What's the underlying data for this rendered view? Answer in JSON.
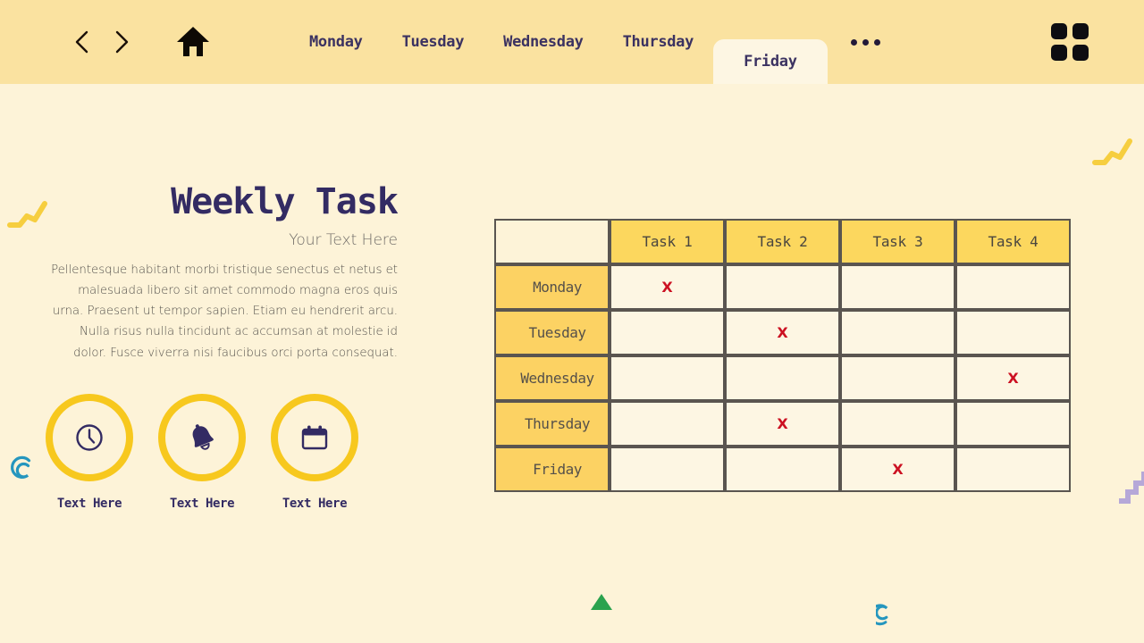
{
  "header": {
    "nav": {
      "back_icon": "chevron-left-icon",
      "forward_icon": "chevron-right-icon",
      "home_icon": "home-icon",
      "more_icon": "ellipsis-icon",
      "grid_icon": "grid-apps-icon"
    },
    "tabs": [
      {
        "label": "Monday",
        "active": false
      },
      {
        "label": "Tuesday",
        "active": false
      },
      {
        "label": "Wednesday",
        "active": false
      },
      {
        "label": "Thursday",
        "active": false
      },
      {
        "label": "Friday",
        "active": true
      }
    ]
  },
  "content": {
    "title": "Weekly Task",
    "subtitle": "Your Text Here",
    "paragraph": "Pellentesque habitant morbi tristique senectus et netus et malesuada libero sit amet commodo magna eros quis urna. Praesent ut tempor sapien. Etiam eu hendrerit arcu. Nulla risus nulla tincidunt ac accumsan at molestie id dolor. Fusce viverra nisi faucibus orci porta consequat.",
    "features": [
      {
        "icon": "clock-icon",
        "caption": "Text Here"
      },
      {
        "icon": "bell-icon",
        "caption": "Text Here"
      },
      {
        "icon": "calendar-icon",
        "caption": "Text Here"
      }
    ]
  },
  "table": {
    "corner_label": "",
    "columns": [
      "Task 1",
      "Task 2",
      "Task 3",
      "Task 4"
    ],
    "rows": [
      {
        "label": "Monday",
        "marks": [
          "X",
          "",
          "",
          ""
        ]
      },
      {
        "label": "Tuesday",
        "marks": [
          "",
          "X",
          "",
          ""
        ]
      },
      {
        "label": "Wednesday",
        "marks": [
          "",
          "",
          "",
          "X"
        ]
      },
      {
        "label": "Thursday",
        "marks": [
          "",
          "X",
          "",
          ""
        ]
      },
      {
        "label": "Friday",
        "marks": [
          "",
          "",
          "X",
          ""
        ]
      }
    ],
    "mark_symbol": "X"
  },
  "colors": {
    "header_bg": "#FAE2A0",
    "page_bg": "#FDF3D8",
    "tab_active_bg": "#FDF6E3",
    "tab_text": "#3B3261",
    "title_text": "#332B63",
    "accent_yellow": "#F7C81E",
    "table_header_bg": "#FCD75E",
    "table_row_bg": "#FCD263",
    "table_cell_bg": "#FDF6E3",
    "table_border": "#5A5550",
    "mark_red": "#CC1122",
    "deco_teal": "#2596BE",
    "deco_green": "#2AA24E",
    "deco_purple": "#B6A8D8",
    "deco_yellow": "#F6CE3F"
  },
  "decorations": [
    {
      "name": "zigzag-line-left",
      "shape": "zigzag",
      "color": "#F6CE3F"
    },
    {
      "name": "zigzag-line-right",
      "shape": "zigzag",
      "color": "#F6CE3F"
    },
    {
      "name": "spiral-left",
      "shape": "spiral",
      "color": "#2596BE"
    },
    {
      "name": "spiral-bottom",
      "shape": "spiral",
      "color": "#2596BE"
    },
    {
      "name": "triangle-bottom",
      "shape": "triangle",
      "color": "#2AA24E"
    },
    {
      "name": "staircase-right",
      "shape": "stairs",
      "color": "#B6A8D8"
    }
  ]
}
